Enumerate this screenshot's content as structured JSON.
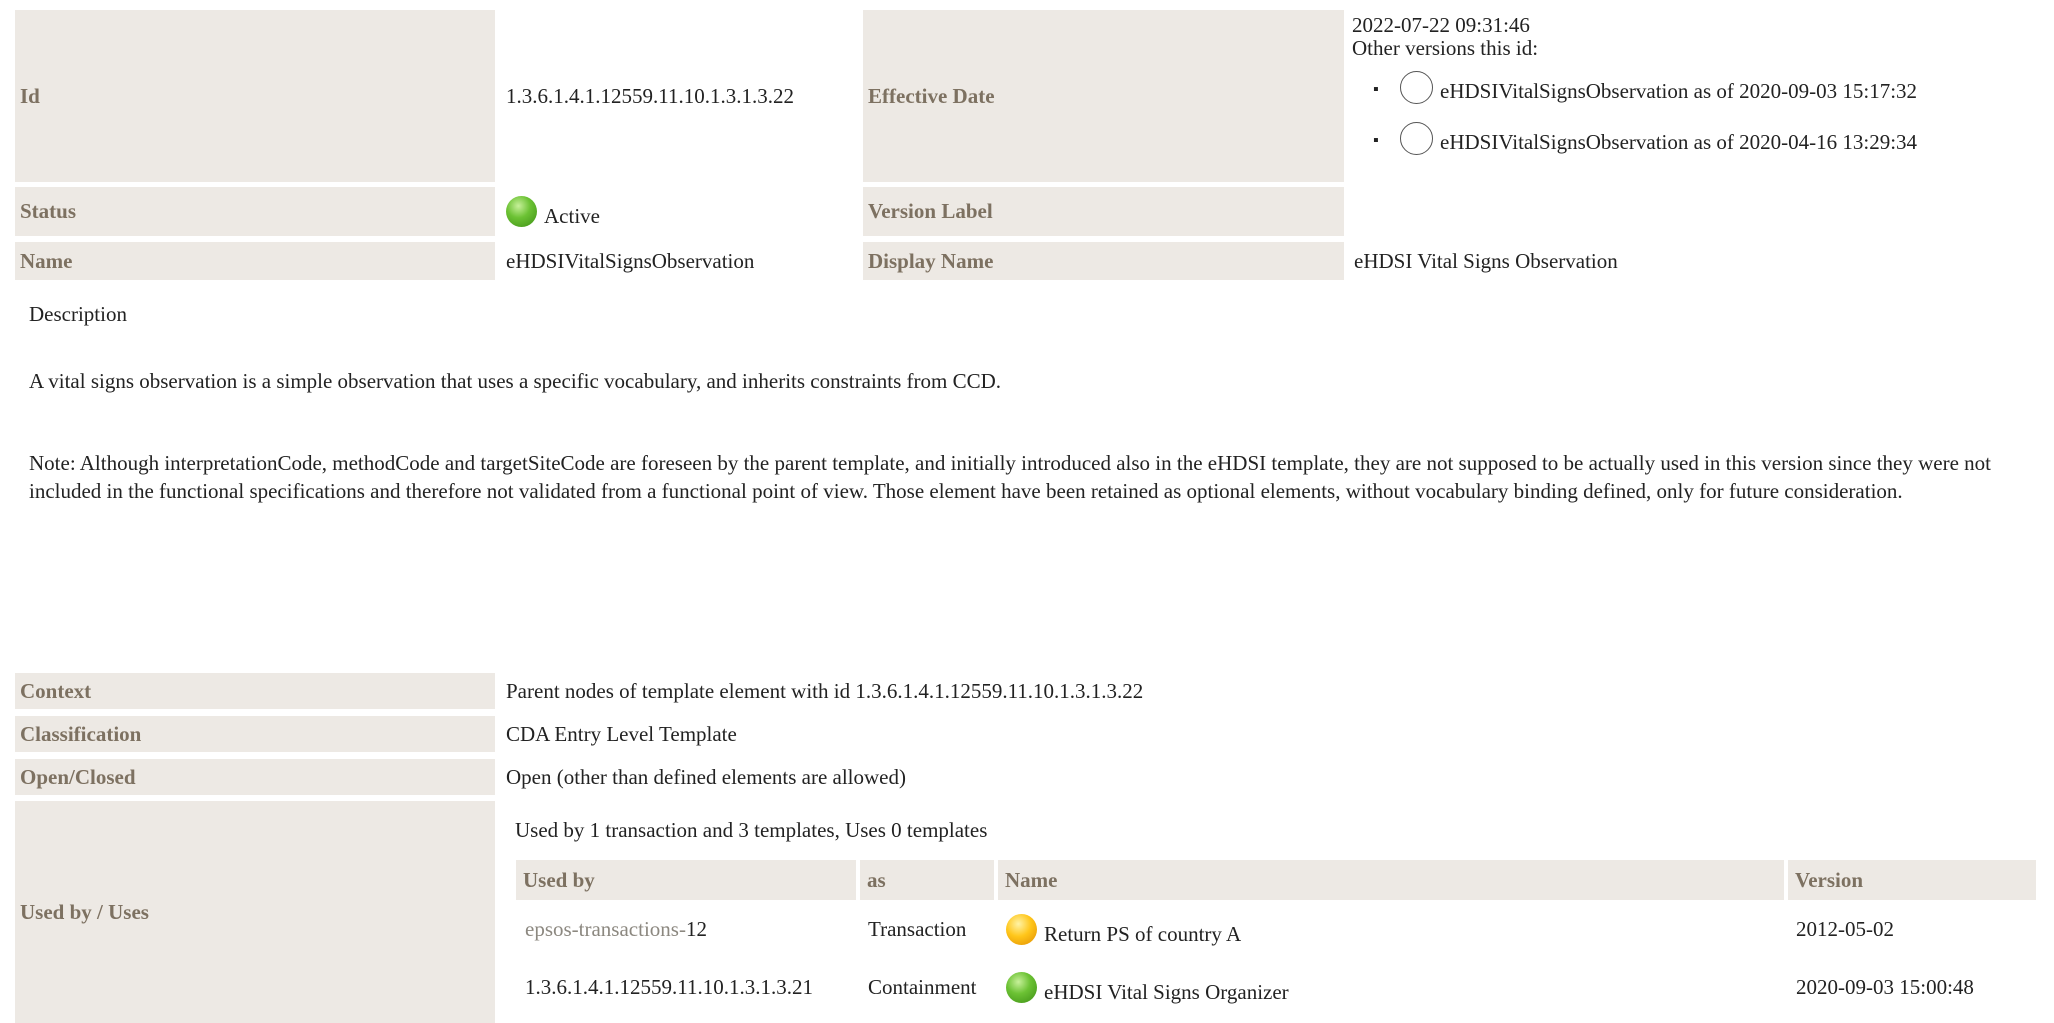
{
  "header": {
    "id_label": "Id",
    "id_value": "1.3.6.1.4.1.12559.11.10.1.3.1.3.22",
    "effective_date_label": "Effective Date",
    "effective_date": "2022-07-22 09:31:46",
    "other_versions_label": "Other versions this id:",
    "other_versions": [
      "eHDSIVitalSignsObservation as of 2020-09-03 15:17:32",
      "eHDSIVitalSignsObservation as of 2020-04-16 13:29:34"
    ],
    "status_label": "Status",
    "status_value": "Active",
    "version_label_label": "Version Label",
    "version_label_value": "",
    "name_label": "Name",
    "name_value": "eHDSIVitalSignsObservation",
    "display_name_label": "Display Name",
    "display_name_value": "eHDSI Vital Signs Observation"
  },
  "description": {
    "title": "Description",
    "paragraph1": "A vital signs observation is a simple observation that uses a specific vocabulary, and inherits constraints from CCD.",
    "paragraph2": "Note: Although interpretationCode, methodCode and targetSiteCode are foreseen by the parent template, and initially introduced also in the eHDSI template, they are not supposed to be actually used in this version since they were not included in the functional specifications and therefore not validated from a functional point of view. Those element have been retained as optional elements, without vocabulary binding defined, only for future consideration."
  },
  "details": {
    "context_label": "Context",
    "context_value": "Parent nodes of template element with id 1.3.6.1.4.1.12559.11.10.1.3.1.3.22",
    "classification_label": "Classification",
    "classification_value": "CDA Entry Level Template",
    "open_closed_label": "Open/Closed",
    "open_closed_value": "Open (other than defined elements are allowed)",
    "used_by_label": "Used by / Uses",
    "used_by_summary": "Used by 1 transaction and 3 templates, Uses 0 templates"
  },
  "usage_table": {
    "columns": [
      "Used by",
      "as",
      "Name",
      "Version"
    ],
    "rows": [
      {
        "used_by_link": "epsos-transactions-",
        "used_by_suffix": "12",
        "as": "Transaction",
        "status": "yellow",
        "name": "Return PS of country A",
        "version": "2012-05-02"
      },
      {
        "used_by_link": "",
        "used_by_suffix": "1.3.6.1.4.1.12559.11.10.1.3.1.3.21",
        "as": "Containment",
        "status": "green",
        "name": "eHDSI Vital Signs Organizer",
        "version": "2020-09-03 15:00:48"
      }
    ]
  },
  "colors": {
    "label_bg": "#ede9e4",
    "label_text": "#7d7161",
    "status_active": "#6cc234",
    "status_pending": "#ffc61a"
  }
}
